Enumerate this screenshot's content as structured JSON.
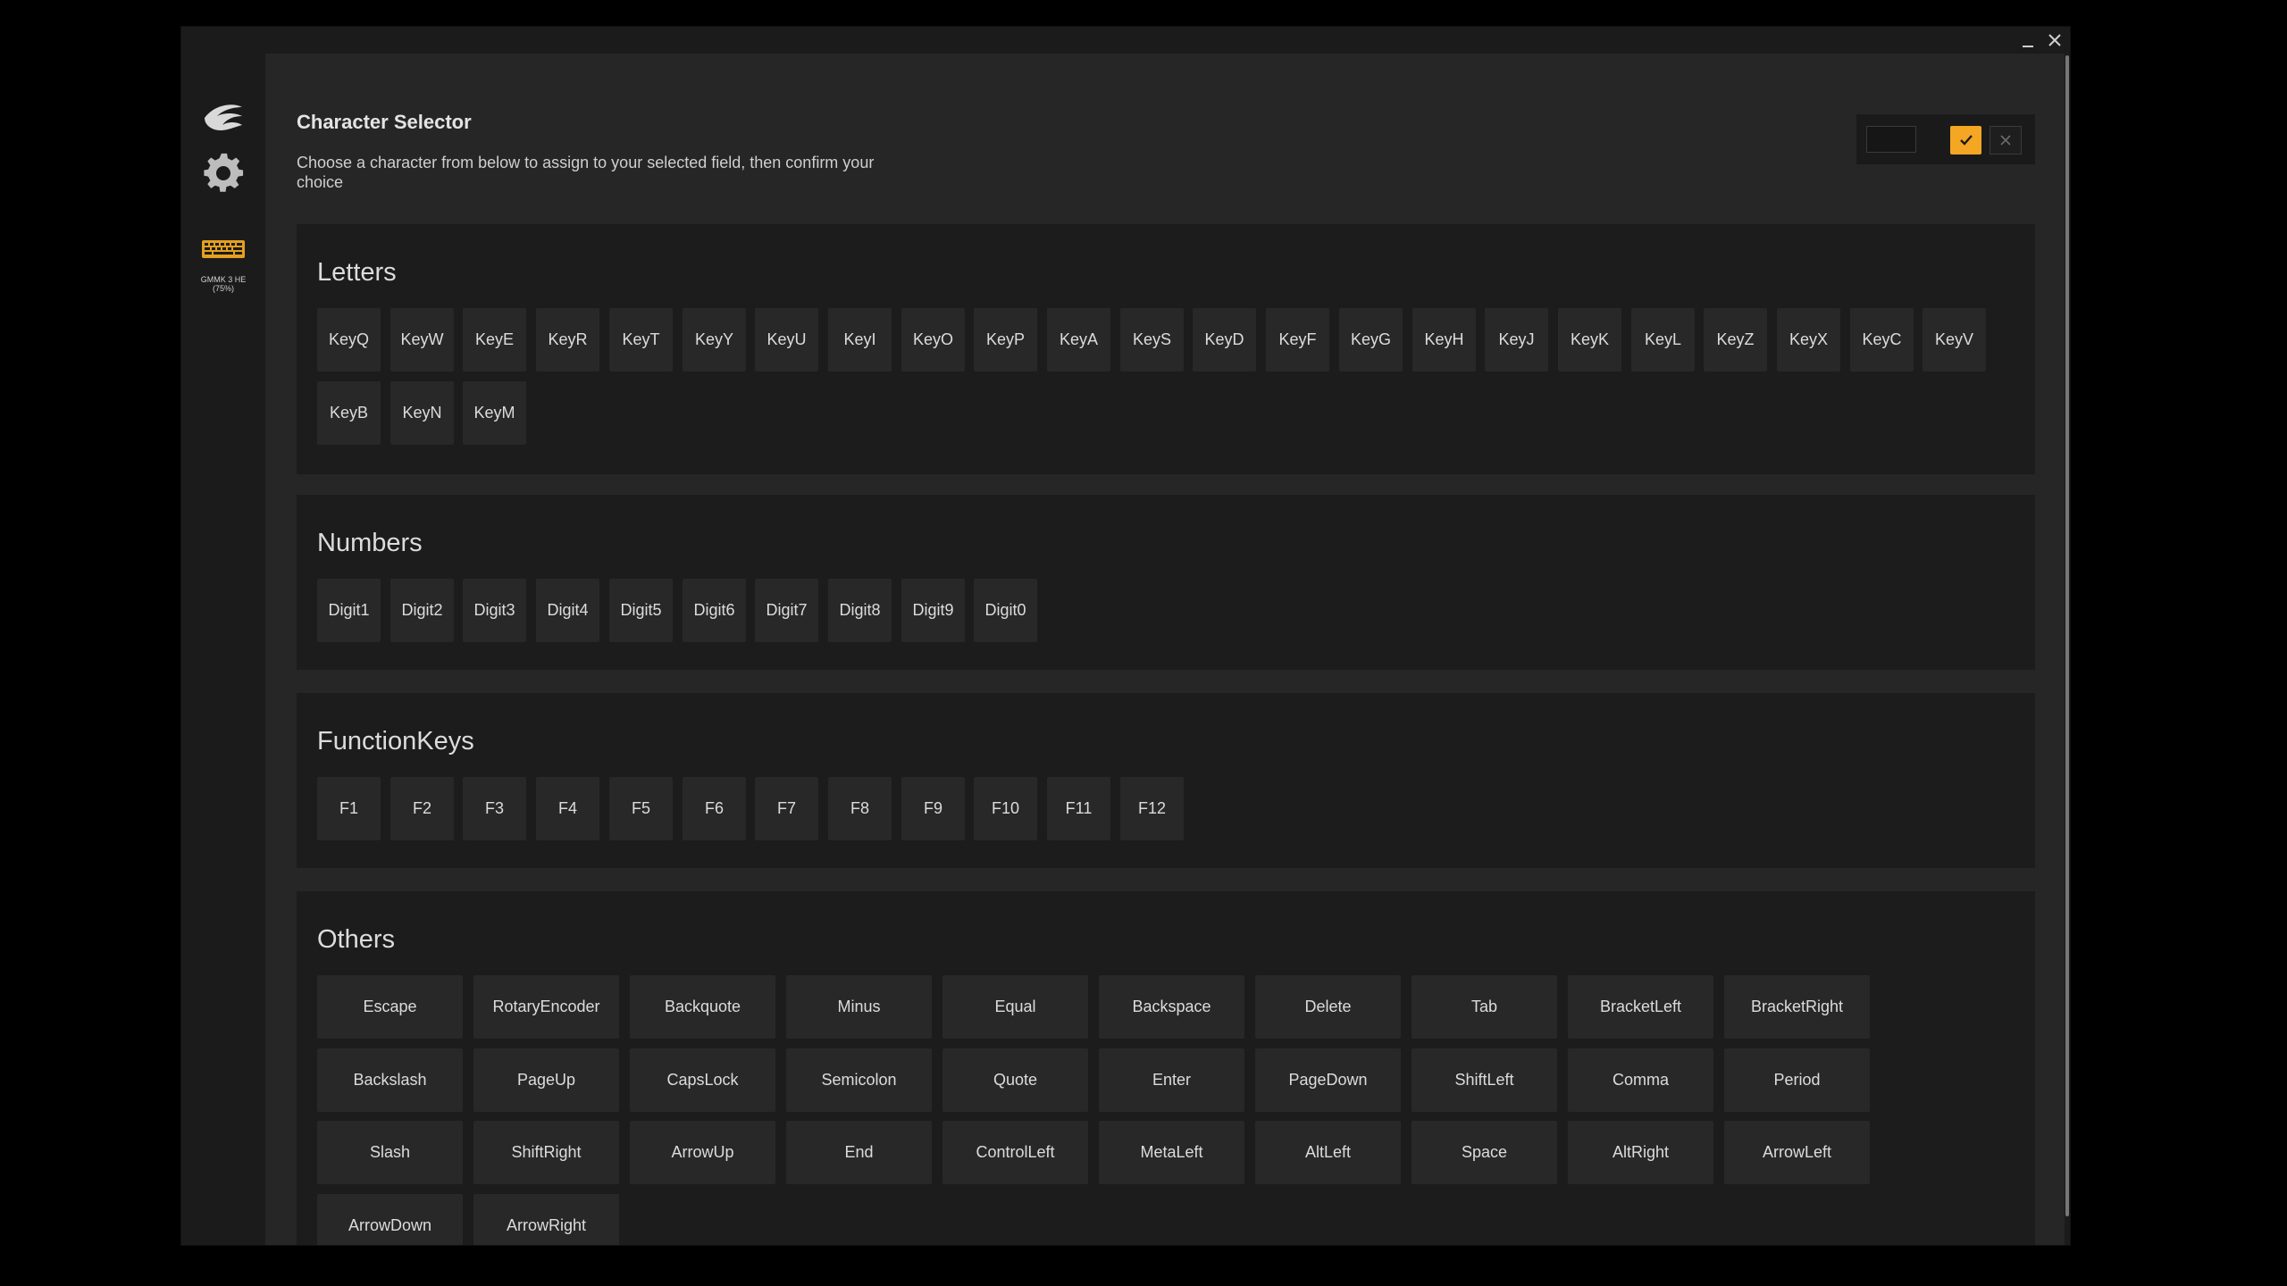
{
  "window": {
    "minimize_label": "–",
    "close_label": "✕"
  },
  "sidebar": {
    "device_label": "GMMK 3 HE (75%)",
    "icons": [
      "brand-logo-icon",
      "gear-icon",
      "keyboard-icon"
    ]
  },
  "header": {
    "title": "Character Selector",
    "description": "Choose a character from below to assign to your selected field, then confirm your choice"
  },
  "actions": {
    "preview_value": "",
    "confirm_icon": "checkmark-icon",
    "cancel_icon": "close-icon",
    "accent_color": "#f5a623"
  },
  "sections": [
    {
      "title": "Letters",
      "keys": [
        "KeyQ",
        "KeyW",
        "KeyE",
        "KeyR",
        "KeyT",
        "KeyY",
        "KeyU",
        "KeyI",
        "KeyO",
        "KeyP",
        "KeyA",
        "KeyS",
        "KeyD",
        "KeyF",
        "KeyG",
        "KeyH",
        "KeyJ",
        "KeyK",
        "KeyL",
        "KeyZ",
        "KeyX",
        "KeyC",
        "KeyV",
        "KeyB",
        "KeyN",
        "KeyM"
      ]
    },
    {
      "title": "Numbers",
      "keys": [
        "Digit1",
        "Digit2",
        "Digit3",
        "Digit4",
        "Digit5",
        "Digit6",
        "Digit7",
        "Digit8",
        "Digit9",
        "Digit0"
      ]
    },
    {
      "title": "FunctionKeys",
      "keys": [
        "F1",
        "F2",
        "F3",
        "F4",
        "F5",
        "F6",
        "F7",
        "F8",
        "F9",
        "F10",
        "F11",
        "F12"
      ]
    },
    {
      "title": "Others",
      "keys": [
        "Escape",
        "RotaryEncoder",
        "Backquote",
        "Minus",
        "Equal",
        "Backspace",
        "Delete",
        "Tab",
        "BracketLeft",
        "BracketRight",
        "Backslash",
        "PageUp",
        "CapsLock",
        "Semicolon",
        "Quote",
        "Enter",
        "PageDown",
        "ShiftLeft",
        "Comma",
        "Period",
        "Slash",
        "ShiftRight",
        "ArrowUp",
        "End",
        "ControlLeft",
        "MetaLeft",
        "AltLeft",
        "Space",
        "AltRight",
        "ArrowLeft",
        "ArrowDown",
        "ArrowRight"
      ]
    }
  ]
}
